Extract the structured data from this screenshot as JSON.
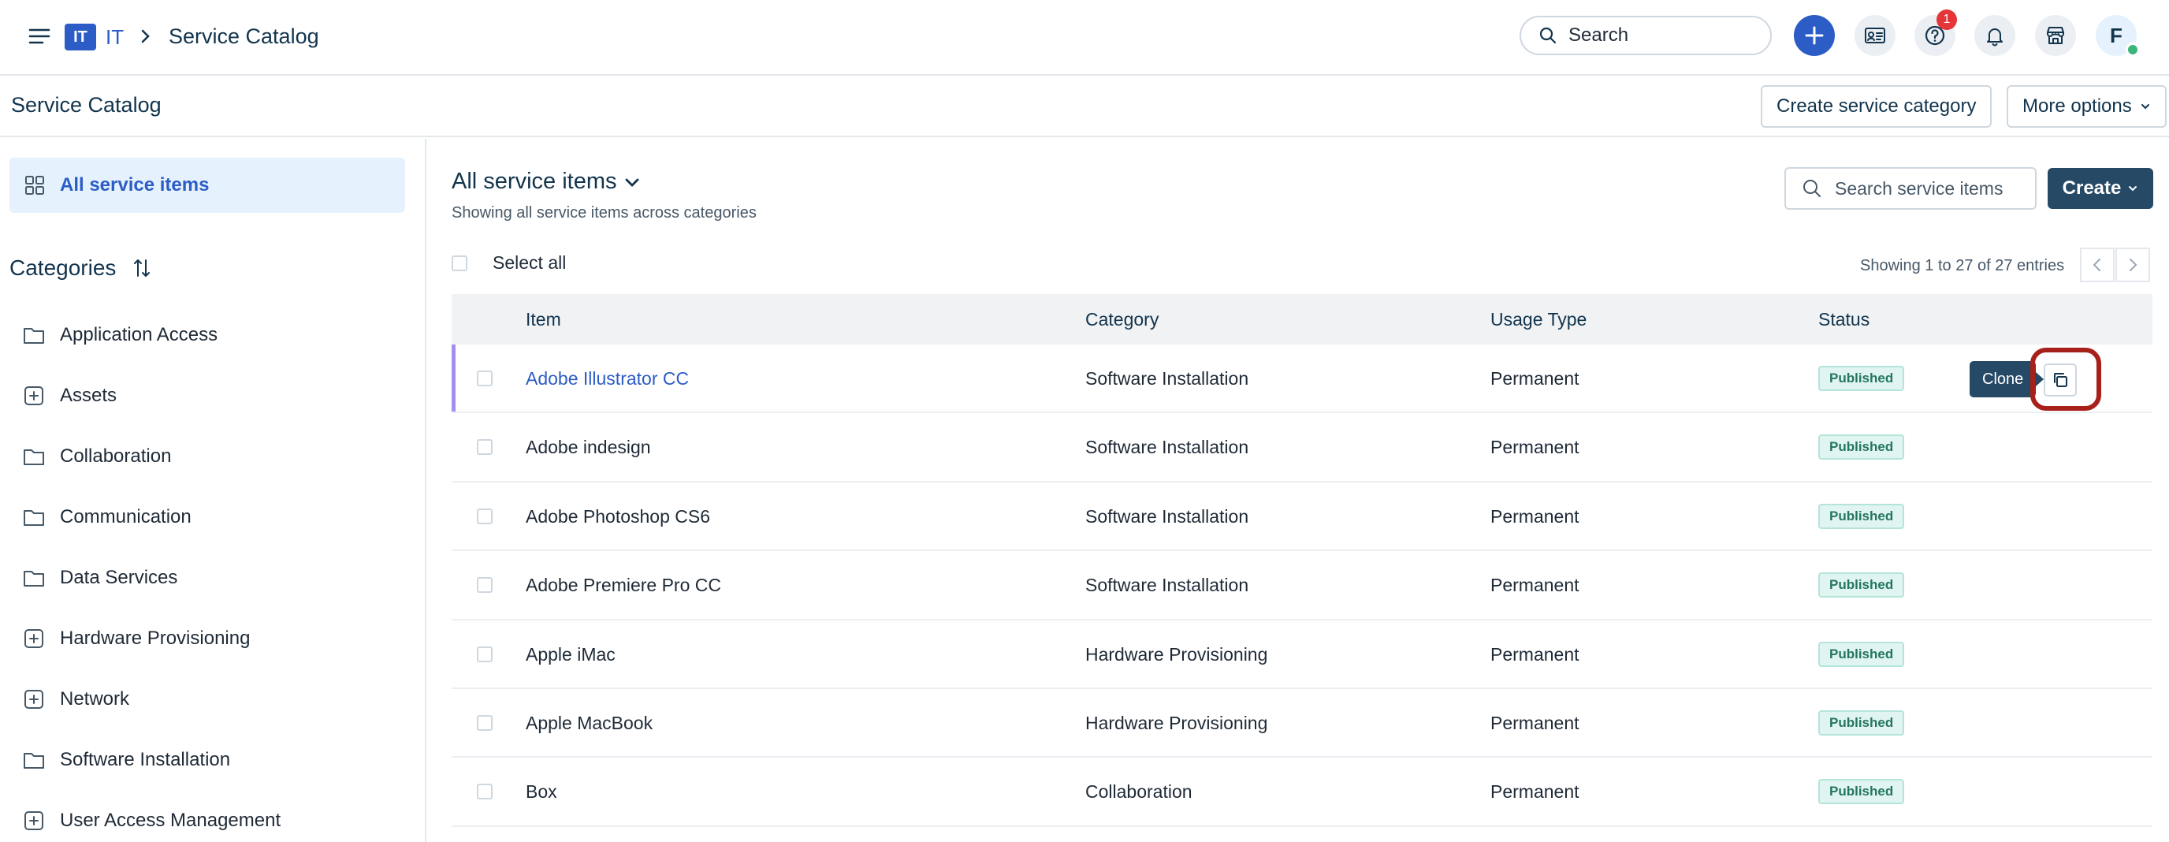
{
  "topbar": {
    "workspace_badge": "IT",
    "workspace_name": "IT",
    "page_name": "Service Catalog",
    "search_placeholder": "Search",
    "notification_count": "1",
    "avatar_initial": "F",
    "status_color": "#3bb57a",
    "accent_color": "#2c5cc5"
  },
  "page_header": {
    "title": "Service Catalog",
    "create_category_label": "Create service category",
    "more_options_label": "More options"
  },
  "sidebar": {
    "all_items_label": "All service items",
    "categories_heading": "Categories",
    "categories": [
      {
        "label": "Application Access",
        "icon": "folder-icon"
      },
      {
        "label": "Assets",
        "icon": "plus-square-icon"
      },
      {
        "label": "Collaboration",
        "icon": "folder-icon"
      },
      {
        "label": "Communication",
        "icon": "folder-icon"
      },
      {
        "label": "Data Services",
        "icon": "folder-icon"
      },
      {
        "label": "Hardware Provisioning",
        "icon": "plus-square-icon"
      },
      {
        "label": "Network",
        "icon": "plus-square-icon"
      },
      {
        "label": "Software Installation",
        "icon": "folder-icon"
      },
      {
        "label": "User Access Management",
        "icon": "plus-square-icon"
      }
    ]
  },
  "main": {
    "title": "All service items",
    "subtitle": "Showing all service items across categories",
    "search_placeholder": "Search service items",
    "create_label": "Create",
    "select_all_label": "Select all",
    "entries_text": "Showing 1 to 27 of 27 entries",
    "columns": [
      "Item",
      "Category",
      "Usage Type",
      "Status"
    ],
    "rows": [
      {
        "item": "Adobe Illustrator CC",
        "category": "Software Installation",
        "usage": "Permanent",
        "status": "Published"
      },
      {
        "item": "Adobe indesign",
        "category": "Software Installation",
        "usage": "Permanent",
        "status": "Published"
      },
      {
        "item": "Adobe Photoshop CS6",
        "category": "Software Installation",
        "usage": "Permanent",
        "status": "Published"
      },
      {
        "item": "Adobe Premiere Pro CC",
        "category": "Software Installation",
        "usage": "Permanent",
        "status": "Published"
      },
      {
        "item": "Apple iMac",
        "category": "Hardware Provisioning",
        "usage": "Permanent",
        "status": "Published"
      },
      {
        "item": "Apple MacBook",
        "category": "Hardware Provisioning",
        "usage": "Permanent",
        "status": "Published"
      },
      {
        "item": "Box",
        "category": "Collaboration",
        "usage": "Permanent",
        "status": "Published"
      }
    ],
    "clone_tooltip": "Clone",
    "highlight_color": "#a8201a"
  }
}
